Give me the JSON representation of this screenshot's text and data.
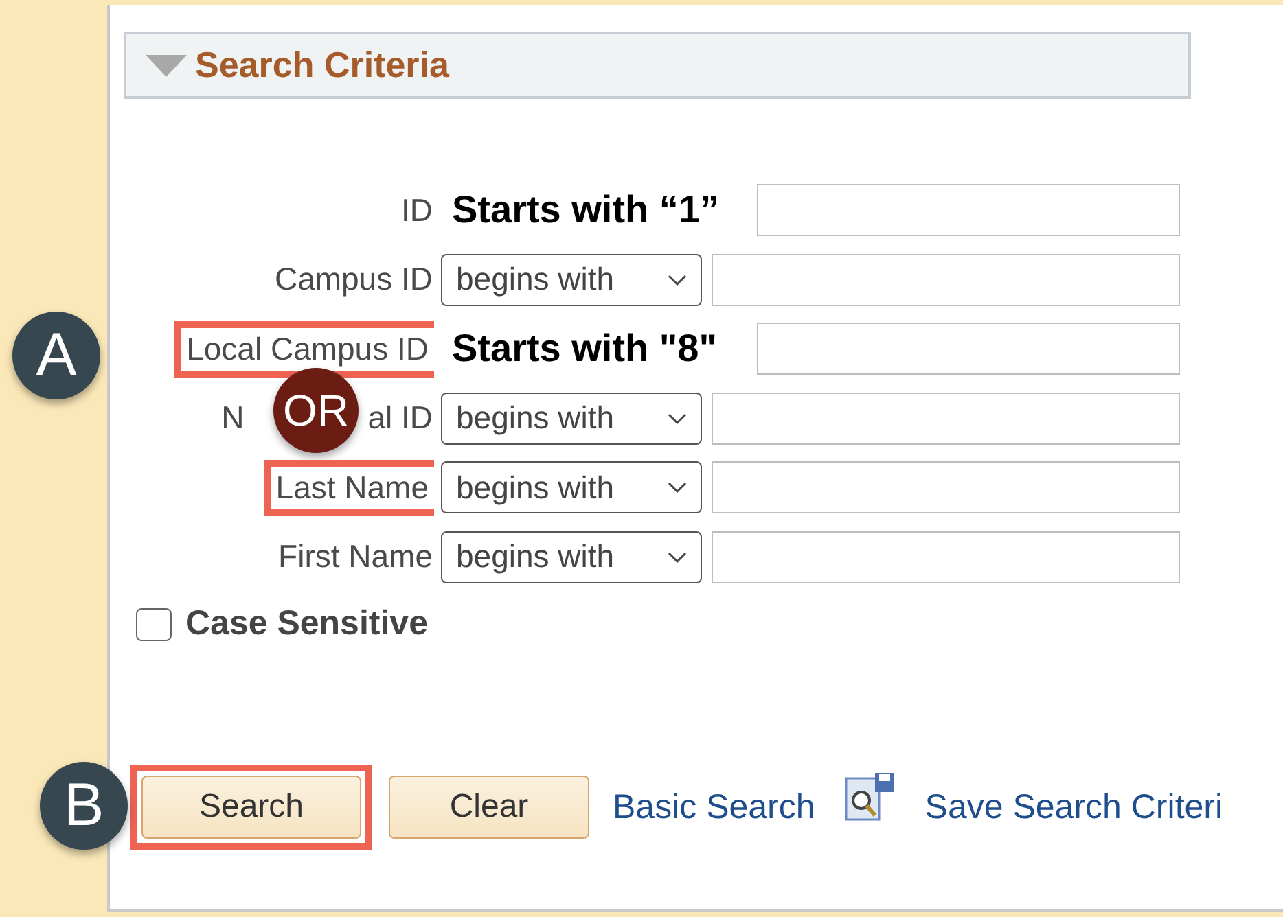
{
  "panel": {
    "title": "Search Criteria",
    "expanded": true
  },
  "rows": [
    {
      "label": "ID",
      "kind": "note",
      "note": "Starts with “1”",
      "highlighted": false
    },
    {
      "label": "Campus ID",
      "kind": "select",
      "operator": "begins with",
      "highlighted": false
    },
    {
      "label": "Local Campus ID",
      "kind": "note",
      "note": "Starts with \"8\"",
      "highlighted": true,
      "callout": {
        "text": "A",
        "color": "#37474f"
      }
    },
    {
      "label": "N",
      "label_tail": "al ID",
      "kind": "select",
      "operator": "begins with",
      "highlighted": false,
      "callout": {
        "text": "OR",
        "color": "#6b1d14"
      }
    },
    {
      "label": "Last Name",
      "kind": "select",
      "operator": "begins with",
      "highlighted": true
    },
    {
      "label": "First Name",
      "kind": "select",
      "operator": "begins with",
      "highlighted": false
    }
  ],
  "case_sensitive": {
    "label": "Case Sensitive",
    "checked": false
  },
  "buttons": [
    {
      "label": "Search",
      "highlighted": true,
      "callout": {
        "text": "B",
        "color": "#37474f"
      }
    },
    {
      "label": "Clear",
      "highlighted": false
    }
  ],
  "links": [
    {
      "label": "Basic Search"
    },
    {
      "label": "Save Search Criteri"
    }
  ]
}
